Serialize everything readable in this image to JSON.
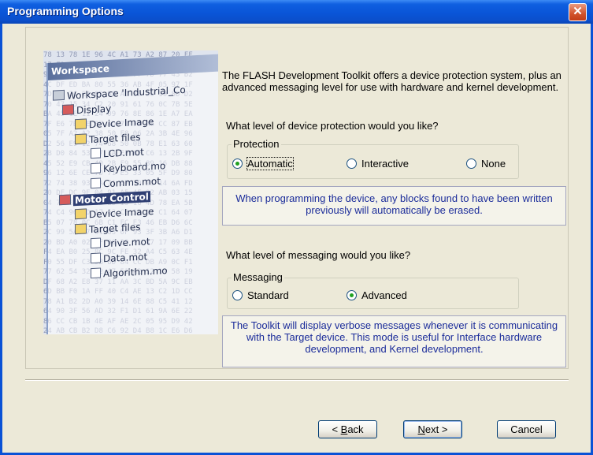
{
  "window": {
    "title": "Programming Options",
    "close_icon": "close-icon"
  },
  "intro": "The FLASH Development Toolkit offers a device protection system, plus an advanced messaging level for use with hardware and kernel development.",
  "protection": {
    "question": "What level of device protection would you like?",
    "group_label": "Protection",
    "options": [
      {
        "label": "Automatic",
        "selected": true
      },
      {
        "label": "Interactive",
        "selected": false
      },
      {
        "label": "None",
        "selected": false
      }
    ],
    "info": "When programming the device, any blocks found to have been written previously will automatically be erased."
  },
  "messaging": {
    "question": "What level of messaging would you like?",
    "group_label": "Messaging",
    "options": [
      {
        "label": "Standard",
        "selected": false
      },
      {
        "label": "Advanced",
        "selected": true
      }
    ],
    "info": "The Toolkit will display verbose messages whenever it is communicating with the Target device. This mode is useful for Interface hardware development, and Kernel development."
  },
  "workspace_image": {
    "header": "Workspace",
    "tree": [
      "Workspace 'Industrial_Co",
      "Display",
      "Device Image",
      "Target files",
      "LCD.mot",
      "Keyboard.mo",
      "Comms.mot",
      "Motor Control",
      "Device Image",
      "Target files",
      "Drive.mot",
      "Data.mot",
      "Algorithm.mo"
    ]
  },
  "buttons": {
    "back_prefix": "< ",
    "back_key": "B",
    "back_rest": "ack",
    "next_key": "N",
    "next_rest": "ext >",
    "cancel": "Cancel"
  },
  "colors": {
    "title_bar": "#0a55d8",
    "dialog_bg": "#ece9d8",
    "info_text": "#1b2c9a",
    "close_button": "#d2522a"
  }
}
